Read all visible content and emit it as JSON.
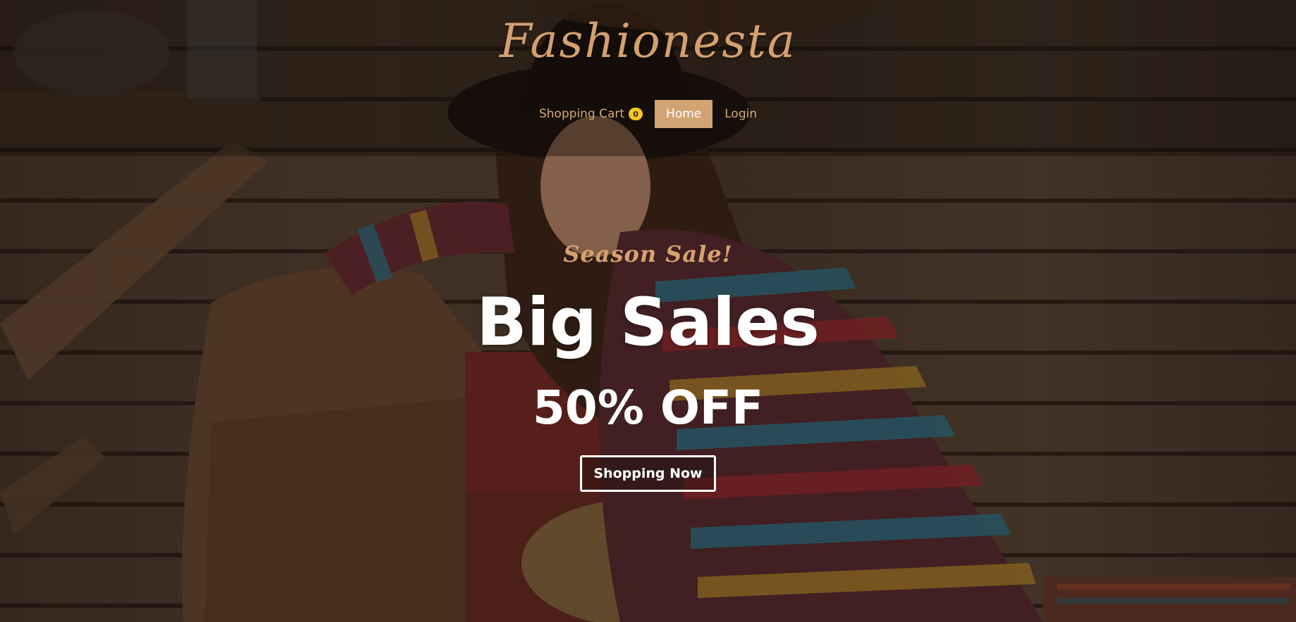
{
  "brand": {
    "name": "Fashionesta"
  },
  "nav": {
    "cart_label": "Shopping Cart",
    "cart_count": "0",
    "home_label": "Home",
    "login_label": "Login"
  },
  "hero": {
    "subtitle": "Season Sale!",
    "title": "Big Sales",
    "discount": "50% OFF",
    "cta_label": "Shopping Now"
  },
  "colors": {
    "accent": "#d2a474",
    "badge": "#f3c623",
    "hero_text": "#ffffff"
  },
  "icons": [
    "hero-photo"
  ]
}
